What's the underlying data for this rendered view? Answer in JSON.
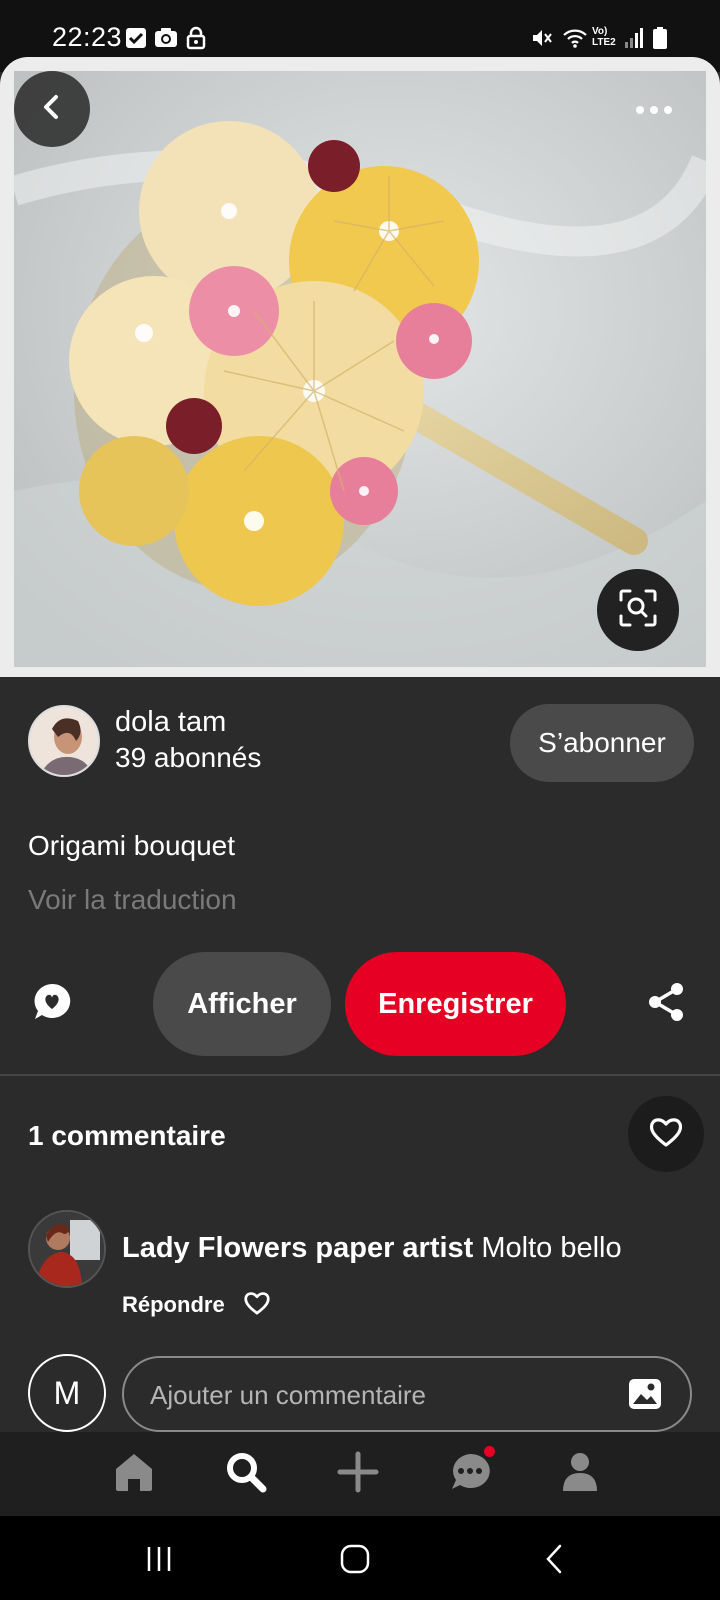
{
  "status_bar": {
    "time": "22:23",
    "lte_label_top": "Vo)",
    "lte_label_bottom": "LTE2"
  },
  "pin": {
    "title": "Origami bouquet",
    "translate_link": "Voir la traduction"
  },
  "creator": {
    "name": "dola tam",
    "followers": "39 abonnés",
    "follow_label": "S’abonner"
  },
  "actions": {
    "view_label": "Afficher",
    "save_label": "Enregistrer"
  },
  "comments": {
    "count_title": "1 commentaire",
    "items": [
      {
        "author": "Lady Flowers paper artist",
        "text": " Molto bello",
        "reply_label": "Répondre"
      }
    ],
    "current_user_initial": "M",
    "input_placeholder": "Ajouter un commentaire"
  },
  "colors": {
    "accent": "#e60023",
    "background": "#2b2b2b",
    "button_gray": "#4a4a4a"
  }
}
